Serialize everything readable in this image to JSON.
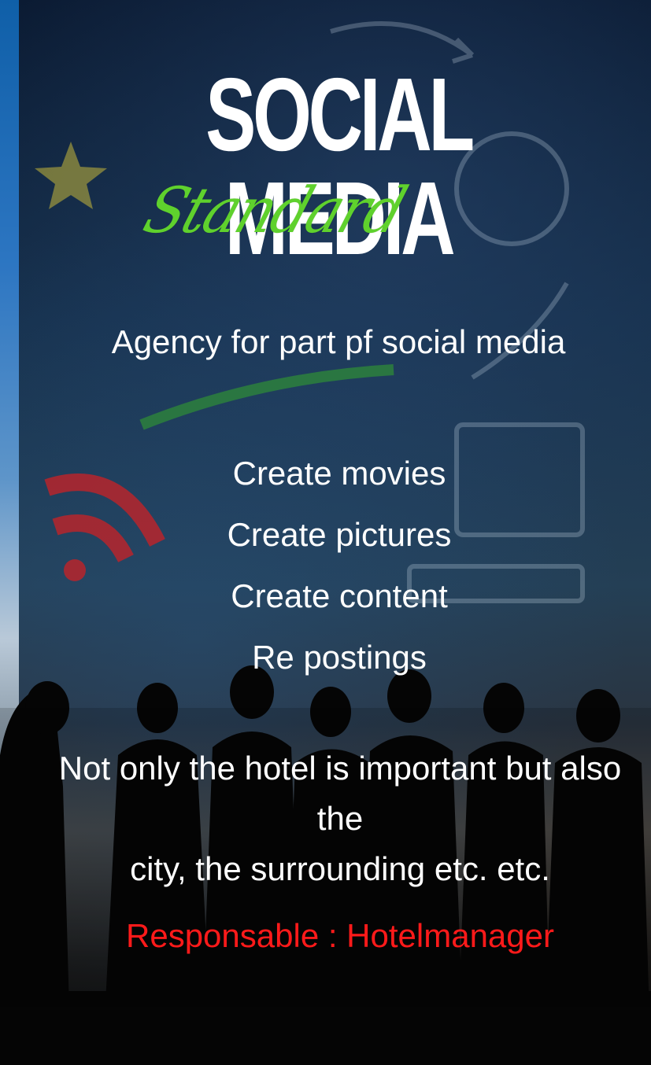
{
  "header": {
    "title": "SOCIAL MEDIA",
    "subtitle": "Standard"
  },
  "intro": {
    "text": "Agency for part pf social media"
  },
  "tasks": [
    "Create movies",
    "Create pictures",
    "Create content",
    "Re postings"
  ],
  "note": {
    "line1": "Not only the hotel is important but also the",
    "line2": "city, the surrounding etc. etc."
  },
  "responsible": {
    "text": "Responsable : Hotelmanager"
  },
  "colors": {
    "title": "#ffffff",
    "subtitle": "#5fd12d",
    "responsible": "#ff1a1a"
  }
}
